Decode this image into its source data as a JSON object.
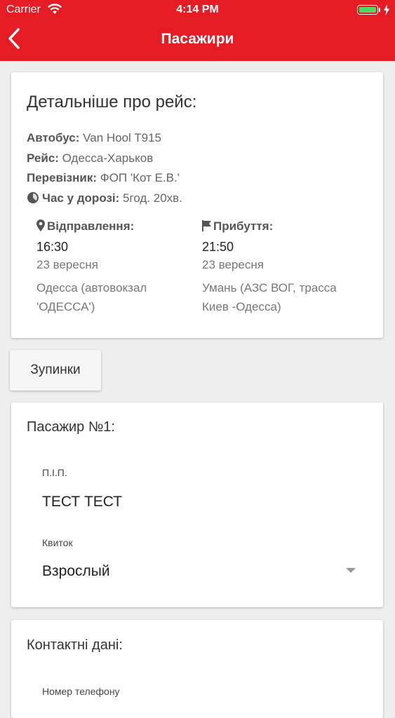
{
  "status_bar": {
    "carrier": "Carrier",
    "time": "4:14 PM",
    "battery_color": "#4cd964"
  },
  "nav": {
    "title": "Пасажири",
    "back_icon": "chevron-left-icon",
    "bar_color": "#e51c23"
  },
  "trip": {
    "title": "Детальніше про рейс:",
    "bus_label": "Автобус:",
    "bus_value": "Van Hool T915",
    "route_label": "Рейс:",
    "route_value": "Одесса-Харьков",
    "carrier_label": "Перевізник:",
    "carrier_value": "ФОП 'Кот Е.В.'",
    "duration_label": "Час у дорозі:",
    "duration_value": "5год. 20хв.",
    "departure": {
      "label": "Відправлення:",
      "time": "16:30",
      "date": "23 вересня",
      "place_line1": "Одесса (автовокзал",
      "place_line2": "'ОДЕССА')"
    },
    "arrival": {
      "label": "Прибуття:",
      "time": "21:50",
      "date": "23 вересня",
      "place_line1": "Умань (АЗС ВОГ, трасса",
      "place_line2": "Киев -Одесса)"
    }
  },
  "stops_button": "Зупинки",
  "passenger": {
    "title": "Пасажир №1:",
    "name_label": "П.І.П.",
    "name_value": "ТЕСТ ТЕСТ",
    "ticket_label": "Квиток",
    "ticket_value": "Взрослый"
  },
  "contacts": {
    "title": "Контактні дані:",
    "phone_label": "Номер телефону"
  }
}
